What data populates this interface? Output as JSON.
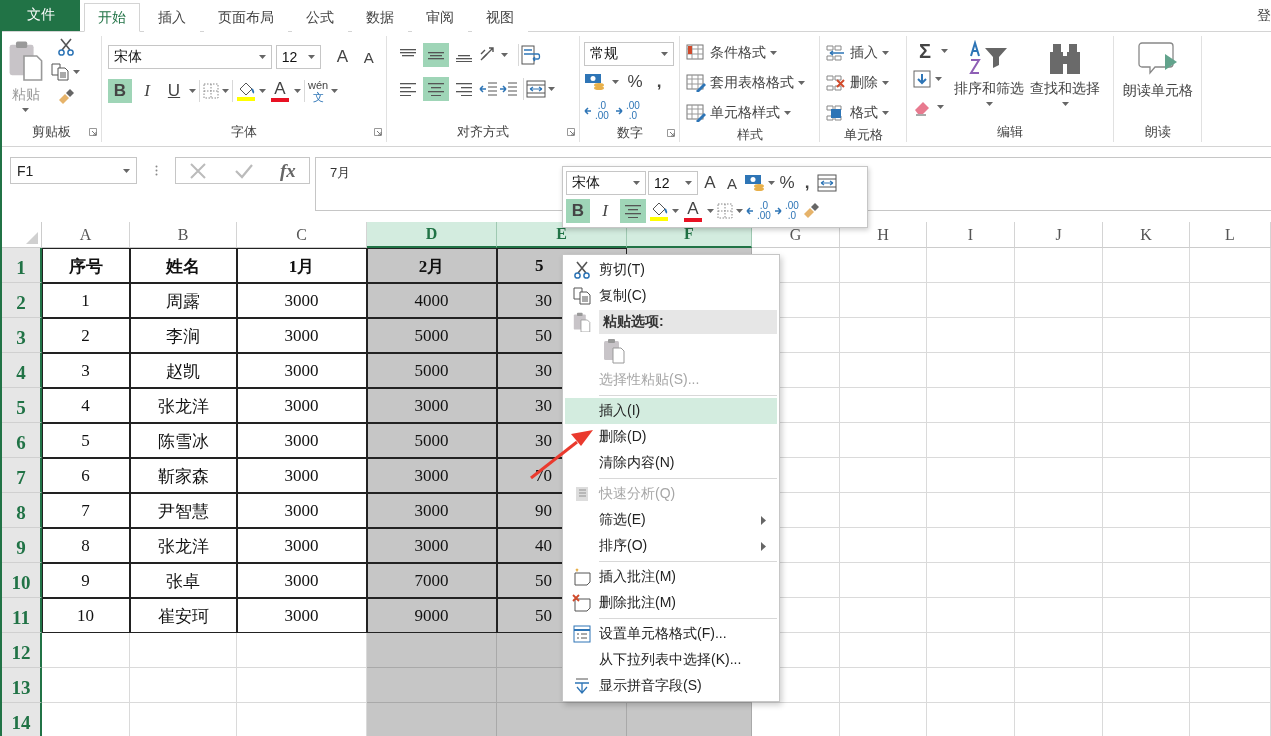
{
  "tabs": {
    "file": "文件",
    "items": [
      {
        "label": "开始",
        "selected": true
      },
      {
        "label": "插入",
        "selected": false
      },
      {
        "label": "页面布局",
        "selected": false
      },
      {
        "label": "公式",
        "selected": false
      },
      {
        "label": "数据",
        "selected": false
      },
      {
        "label": "审阅",
        "selected": false
      },
      {
        "label": "视图",
        "selected": false
      }
    ],
    "account": "登"
  },
  "ribbon": {
    "clipboard": {
      "label": "剪贴板",
      "paste": "粘贴"
    },
    "font": {
      "label": "字体",
      "font_name": "宋体",
      "font_size": "12",
      "grow": "A",
      "shrink": "A",
      "bold": {
        "text": "B",
        "on": true
      },
      "italic": {
        "text": "I",
        "on": false
      },
      "underline": {
        "text": "U",
        "on": false
      },
      "font_color": "A",
      "phonetic": {
        "top": "wén",
        "bottom": "文"
      }
    },
    "alignment": {
      "label": "对齐方式",
      "buttons": [
        {
          "kind": "top",
          "on": false
        },
        {
          "kind": "middle",
          "on": true
        },
        {
          "kind": "bottom",
          "on": false
        },
        {
          "kind": "left",
          "on": false
        },
        {
          "kind": "center",
          "on": true
        },
        {
          "kind": "right",
          "on": false
        }
      ]
    },
    "number": {
      "label": "数字",
      "format": "常规",
      "percent": "%",
      "comma": ",",
      "increase_decimal": {
        "top": ".0",
        "bottom": ".00"
      },
      "decrease_decimal": {
        "top": ".00",
        "bottom": ".0"
      }
    },
    "styles": {
      "label": "样式",
      "buttons": [
        "条件格式",
        "套用表格格式",
        "单元格样式"
      ]
    },
    "cells": {
      "label": "单元格",
      "buttons": [
        "插入",
        "删除",
        "格式"
      ]
    },
    "editing": {
      "label": "编辑",
      "sum": "Σ",
      "sort": "排序和筛选",
      "find": "查找和选择"
    },
    "read": {
      "label": "朗读",
      "button": "朗读单元格"
    }
  },
  "formula_bar": {
    "name_box": "F1",
    "function": "fx",
    "formula": "7月"
  },
  "mini_toolbar": {
    "font_name": "宋体",
    "font_size": "12",
    "grow": "A",
    "shrink": "A",
    "percent": "%",
    "comma": ",",
    "bold": {
      "text": "B",
      "on": true
    },
    "italic": {
      "text": "I",
      "on": false
    },
    "center": {
      "on": true
    },
    "font_color": "A",
    "increase_decimal": {
      "top": ".0",
      "bottom": ".00"
    },
    "decrease_decimal": {
      "top": ".00",
      "bottom": ".0"
    }
  },
  "grid": {
    "columns": [
      {
        "label": "A",
        "selected": false
      },
      {
        "label": "B",
        "selected": false
      },
      {
        "label": "C",
        "selected": false
      },
      {
        "label": "D",
        "selected": true
      },
      {
        "label": "E",
        "selected": true
      },
      {
        "label": "F",
        "selected": true
      },
      {
        "label": "G",
        "selected": false
      },
      {
        "label": "H",
        "selected": false
      },
      {
        "label": "I",
        "selected": false
      },
      {
        "label": "J",
        "selected": false
      },
      {
        "label": "K",
        "selected": false
      },
      {
        "label": "L",
        "selected": false
      }
    ],
    "rows": [
      {
        "number": "1",
        "cells": [
          "序号",
          "姓名",
          "1月",
          "2月",
          "5"
        ]
      },
      {
        "number": "2",
        "cells": [
          "1",
          "周露",
          "3000",
          "4000",
          "30"
        ]
      },
      {
        "number": "3",
        "cells": [
          "2",
          "李涧",
          "3000",
          "5000",
          "50"
        ]
      },
      {
        "number": "4",
        "cells": [
          "3",
          "赵凯",
          "3000",
          "5000",
          "30"
        ]
      },
      {
        "number": "5",
        "cells": [
          "4",
          "张龙洋",
          "3000",
          "3000",
          "30"
        ]
      },
      {
        "number": "6",
        "cells": [
          "5",
          "陈雪冰",
          "3000",
          "5000",
          "30"
        ]
      },
      {
        "number": "7",
        "cells": [
          "6",
          "靳家森",
          "3000",
          "3000",
          "70"
        ]
      },
      {
        "number": "8",
        "cells": [
          "7",
          "尹智慧",
          "3000",
          "3000",
          "90"
        ]
      },
      {
        "number": "9",
        "cells": [
          "8",
          "张龙洋",
          "3000",
          "3000",
          "40"
        ]
      },
      {
        "number": "10",
        "cells": [
          "9",
          "张卓",
          "3000",
          "7000",
          "50"
        ]
      },
      {
        "number": "11",
        "cells": [
          "10",
          "崔安珂",
          "3000",
          "9000",
          "50"
        ]
      },
      {
        "number": "12"
      },
      {
        "number": "13"
      },
      {
        "number": "14"
      }
    ]
  },
  "context_menu": {
    "items": [
      {
        "kind": "command",
        "label": "剪切(T)",
        "selected": false,
        "disabled": false,
        "submenu": false
      },
      {
        "kind": "command",
        "label": "复制(C)",
        "selected": false,
        "disabled": false,
        "submenu": false
      },
      {
        "kind": "header",
        "label": "粘贴选项:"
      },
      {
        "kind": "paste-options"
      },
      {
        "kind": "command",
        "label": "选择性粘贴(S)...",
        "selected": false,
        "disabled": true,
        "submenu": false
      },
      {
        "kind": "separator"
      },
      {
        "kind": "command",
        "label": "插入(I)",
        "selected": true,
        "disabled": false,
        "submenu": false
      },
      {
        "kind": "command",
        "label": "删除(D)",
        "selected": false,
        "disabled": false,
        "submenu": false
      },
      {
        "kind": "command",
        "label": "清除内容(N)",
        "selected": false,
        "disabled": false,
        "submenu": false
      },
      {
        "kind": "separator"
      },
      {
        "kind": "command",
        "label": "快速分析(Q)",
        "selected": false,
        "disabled": true,
        "submenu": false
      },
      {
        "kind": "command",
        "label": "筛选(E)",
        "selected": false,
        "disabled": false,
        "submenu": true
      },
      {
        "kind": "command",
        "label": "排序(O)",
        "selected": false,
        "disabled": false,
        "submenu": true
      },
      {
        "kind": "separator"
      },
      {
        "kind": "command",
        "label": "插入批注(M)",
        "selected": false,
        "disabled": false,
        "submenu": false
      },
      {
        "kind": "command",
        "label": "删除批注(M)",
        "selected": false,
        "disabled": false,
        "submenu": false
      },
      {
        "kind": "separator"
      },
      {
        "kind": "command",
        "label": "设置单元格格式(F)...",
        "selected": false,
        "disabled": false,
        "submenu": false
      },
      {
        "kind": "command",
        "label": "从下拉列表中选择(K)...",
        "selected": false,
        "disabled": false,
        "submenu": false
      },
      {
        "kind": "command",
        "label": "显示拼音字段(S)",
        "selected": false,
        "disabled": false,
        "submenu": false
      }
    ]
  }
}
